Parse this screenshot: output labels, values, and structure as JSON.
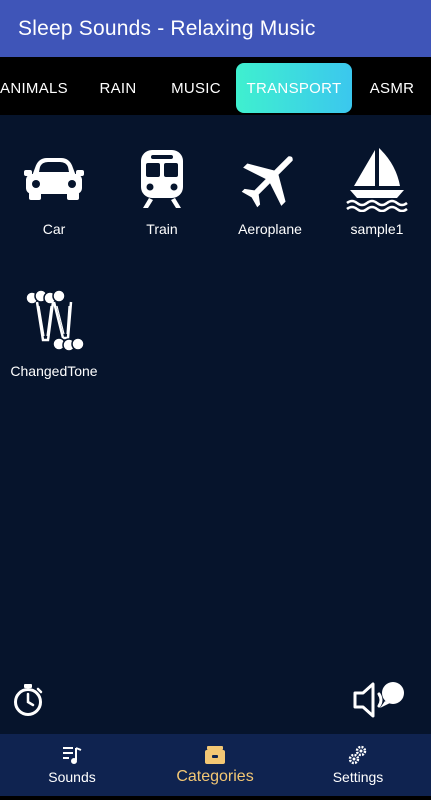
{
  "appbar": {
    "title": "Sleep Sounds - Relaxing Music"
  },
  "tabs": [
    {
      "label": "ANIMALS"
    },
    {
      "label": "RAIN"
    },
    {
      "label": "MUSIC"
    },
    {
      "label": "TRANSPORT",
      "selected": true
    },
    {
      "label": "ASMR"
    }
  ],
  "sounds": [
    {
      "label": "Car",
      "icon": "car-icon"
    },
    {
      "label": "Train",
      "icon": "train-icon"
    },
    {
      "label": "Aeroplane",
      "icon": "airplane-icon"
    },
    {
      "label": "sample1",
      "icon": "sailboat-icon"
    },
    {
      "label": "ChangedTone",
      "icon": "wind-chimes-icon"
    }
  ],
  "controls": {
    "timer_icon": "timer-icon",
    "volume_icon": "volume-icon"
  },
  "bottom_nav": [
    {
      "label": "Sounds",
      "icon": "music-list-icon"
    },
    {
      "label": "Categories",
      "icon": "categories-icon",
      "active": true
    },
    {
      "label": "Settings",
      "icon": "gears-icon"
    }
  ],
  "colors": {
    "appbar": "#3f55b8",
    "background": "#06142c",
    "tab_bar": "#000000",
    "selected_tab_gradient_start": "#3ff0cf",
    "selected_tab_gradient_end": "#3bc7ee",
    "bottom_nav": "#0f2350",
    "active_nav_label": "#f3c774"
  }
}
